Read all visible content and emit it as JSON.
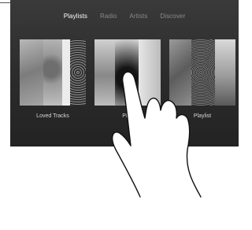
{
  "tabs": [
    {
      "label": "Playlists",
      "active": true
    },
    {
      "label": "Radio",
      "active": false
    },
    {
      "label": "Artists",
      "active": false
    },
    {
      "label": "Discover",
      "active": false
    }
  ],
  "playlists": [
    {
      "label": "Loved Tracks"
    },
    {
      "label": "Play"
    },
    {
      "label": "Playlist"
    }
  ],
  "colors": {
    "screen_bg": "#2e2e2e",
    "tab_active": "#ffffff",
    "tab_inactive": "#8a8a8a"
  }
}
